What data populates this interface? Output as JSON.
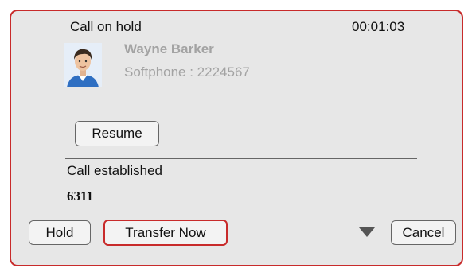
{
  "call_panel": {
    "status_title": "Call on hold",
    "timer": "00:01:03",
    "contact": {
      "name": "Wayne Barker",
      "detail": "Softphone  :  2224567",
      "avatar_icon": "person-photo-icon"
    },
    "resume_label": "Resume",
    "established_label": "Call established",
    "established_number": "6311"
  },
  "footer": {
    "hold_label": "Hold",
    "transfer_label": "Transfer Now",
    "dropdown_icon": "triangle-down-icon",
    "cancel_label": "Cancel"
  },
  "colors": {
    "panel_background": "#e7e7e7",
    "accent_red": "#c82b2b",
    "muted_text": "#a3a3a3"
  }
}
